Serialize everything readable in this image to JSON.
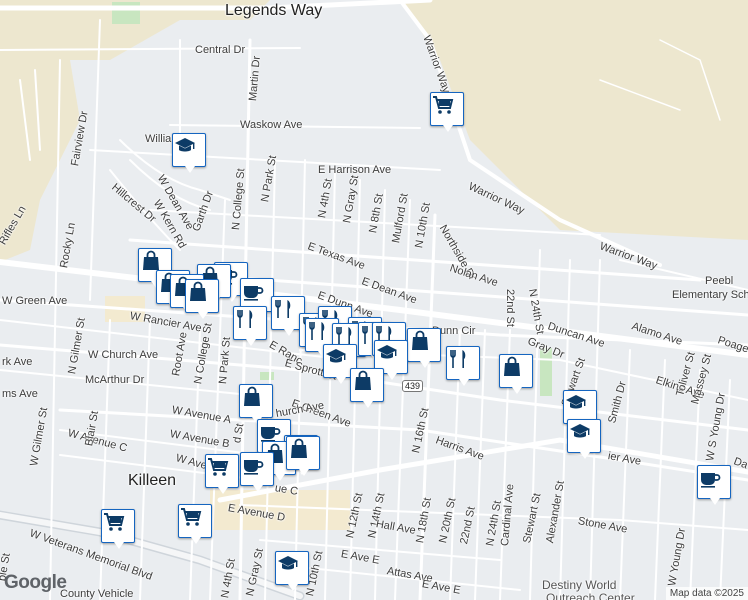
{
  "map": {
    "attribution": "Map data ©2025",
    "logo": "Google",
    "highway_shield": "439",
    "city_label": "Killeen",
    "labels": [
      {
        "text": "Legends Way",
        "cls": "big"
      },
      {
        "text": "Central Dr"
      },
      {
        "text": "Martin Dr"
      },
      {
        "text": "Warrior Way"
      },
      {
        "text": "Waskow Ave"
      },
      {
        "text": "William"
      },
      {
        "text": "Fairview Dr"
      },
      {
        "text": "E Harrison Ave"
      },
      {
        "text": "Hillcrest Dr"
      },
      {
        "text": "W Dean Ave"
      },
      {
        "text": "W Kern Rd"
      },
      {
        "text": "Garth Dr"
      },
      {
        "text": "N College St"
      },
      {
        "text": "N Park St"
      },
      {
        "text": "N 4th St"
      },
      {
        "text": "N Gray St"
      },
      {
        "text": "N 8th St"
      },
      {
        "text": "Mulford St"
      },
      {
        "text": "N 10th St"
      },
      {
        "text": "Northside Dr"
      },
      {
        "text": "Warrior Way"
      },
      {
        "text": "Warrior Way"
      },
      {
        "text": "Rifles Ln"
      },
      {
        "text": "Rocky Ln"
      },
      {
        "text": "E Texas Ave"
      },
      {
        "text": "E Dean Ave"
      },
      {
        "text": "Nolan Ave"
      },
      {
        "text": "22nd St"
      },
      {
        "text": "N 24th St"
      },
      {
        "text": "Peebl"
      },
      {
        "text": "Elementary Scho"
      },
      {
        "text": "W Green Ave"
      },
      {
        "text": "N Gilmer St"
      },
      {
        "text": "W Rancier Ave"
      },
      {
        "text": "E Dunn Ave"
      },
      {
        "text": "Duncan Ave"
      },
      {
        "text": "Alamo Ave"
      },
      {
        "text": "Poage"
      },
      {
        "text": "Dunn Cir"
      },
      {
        "text": "Gray Dr"
      },
      {
        "text": "rk Ave"
      },
      {
        "text": "W Church Ave"
      },
      {
        "text": "Root Ave"
      },
      {
        "text": "N College St"
      },
      {
        "text": "N Park St"
      },
      {
        "text": "E Ranc"
      },
      {
        "text": "E Sprott St"
      },
      {
        "text": "McArthur Dr"
      },
      {
        "text": "ms Ave"
      },
      {
        "text": "Elkins Ave"
      },
      {
        "text": "Toliver St"
      },
      {
        "text": "Smith Dr"
      },
      {
        "text": "Massey St"
      },
      {
        "text": "W S Young Dr"
      },
      {
        "text": "Stewart St"
      },
      {
        "text": "E Green Ave"
      },
      {
        "text": "W Avenue A"
      },
      {
        "text": "hurch Ave"
      },
      {
        "text": "W Avenue C"
      },
      {
        "text": "W Avenue B"
      },
      {
        "text": "Harris Ave"
      },
      {
        "text": "N 16th St"
      },
      {
        "text": "ier Ave"
      },
      {
        "text": "Da"
      },
      {
        "text": "Blair St"
      },
      {
        "text": "W Gilmer St"
      },
      {
        "text": "W Avenu"
      },
      {
        "text": "ue C"
      },
      {
        "text": "N 12th St"
      },
      {
        "text": "N 14th St"
      },
      {
        "text": "N 18th St"
      },
      {
        "text": "N 20th St"
      },
      {
        "text": "22nd St"
      },
      {
        "text": "N 24th St"
      },
      {
        "text": "Cardinal Ave"
      },
      {
        "text": "Stewart St"
      },
      {
        "text": "Alexander St"
      },
      {
        "text": "Stone Ave"
      },
      {
        "text": "E Avenue D"
      },
      {
        "text": "Hall Ave"
      },
      {
        "text": "W Veterans Memorial Blvd"
      },
      {
        "text": "N 4th St"
      },
      {
        "text": "N Gray St"
      },
      {
        "text": "N 10th St"
      },
      {
        "text": "E Ave E"
      },
      {
        "text": "Attas Ave"
      },
      {
        "text": "E Ave E"
      },
      {
        "text": "W Young Dr"
      },
      {
        "text": "ple St"
      },
      {
        "text": "County Vehicle"
      },
      {
        "text": "Destiny World",
        "cls": "poi"
      },
      {
        "text": "Outreach Center",
        "cls": "poi"
      },
      {
        "text": "d St"
      }
    ],
    "markers": [
      {
        "icon": "school"
      },
      {
        "icon": "shopping-cart"
      },
      {
        "icon": "shopping-bag"
      },
      {
        "icon": "coffee"
      },
      {
        "icon": "shopping-bag"
      },
      {
        "icon": "shopping-bag"
      },
      {
        "icon": "shopping-bag"
      },
      {
        "icon": "shopping-bag"
      },
      {
        "icon": "coffee"
      },
      {
        "icon": "restaurant"
      },
      {
        "icon": "restaurant"
      },
      {
        "icon": "restaurant"
      },
      {
        "icon": "restaurant"
      },
      {
        "icon": "restaurant"
      },
      {
        "icon": "restaurant"
      },
      {
        "icon": "restaurant"
      },
      {
        "icon": "restaurant"
      },
      {
        "icon": "restaurant"
      },
      {
        "icon": "shopping-bag"
      },
      {
        "icon": "school"
      },
      {
        "icon": "school"
      },
      {
        "icon": "shopping-bag"
      },
      {
        "icon": "restaurant"
      },
      {
        "icon": "shopping-bag"
      },
      {
        "icon": "school"
      },
      {
        "icon": "school"
      },
      {
        "icon": "shopping-bag"
      },
      {
        "icon": "coffee"
      },
      {
        "icon": "shopping-bag"
      },
      {
        "icon": "shopping-bag"
      },
      {
        "icon": "shopping-bag"
      },
      {
        "icon": "coffee"
      },
      {
        "icon": "shopping-cart"
      },
      {
        "icon": "shopping-cart"
      },
      {
        "icon": "shopping-cart"
      },
      {
        "icon": "school"
      },
      {
        "icon": "coffee"
      }
    ],
    "colors": {
      "background": "#eaedf0",
      "road": "#ffffff",
      "park": "#c8e6c0",
      "base_area": "#ede7cf",
      "marker_icon": "#0d3b66"
    }
  }
}
